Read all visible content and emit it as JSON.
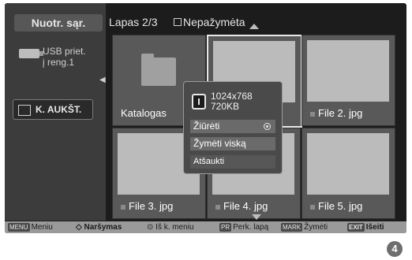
{
  "sidebar": {
    "title": "Nuotr. sąr.",
    "device": [
      "USB priet.",
      "į reng.1"
    ],
    "back_label": "K. AUKŠT."
  },
  "header": {
    "page": "Lapas 2/3",
    "mark_filter": "Nepažymėta"
  },
  "tiles": [
    {
      "label": "Katalogas"
    },
    {
      "label": ""
    },
    {
      "label": "File 2. jpg"
    },
    {
      "label": "File 3. jpg"
    },
    {
      "label": "File 4. jpg"
    },
    {
      "label": "File 5. jpg"
    }
  ],
  "popup": {
    "resolution": "1024x768",
    "size": "720KB",
    "items": [
      "Žiūrėti",
      "Žymėti viską",
      "Atšaukti"
    ]
  },
  "footer": {
    "menu": {
      "key": "MENU",
      "label": "Meniu"
    },
    "nav": {
      "label": "Naršymas"
    },
    "exit_menu": {
      "label": "Iš k. meniu"
    },
    "page": {
      "key": "PR",
      "label": "Perk. lapą"
    },
    "mark": {
      "key": "MARK",
      "label": "Žymėti"
    },
    "exit": {
      "key": "EXIT",
      "label": "Išeiti"
    }
  },
  "step_number": "4"
}
